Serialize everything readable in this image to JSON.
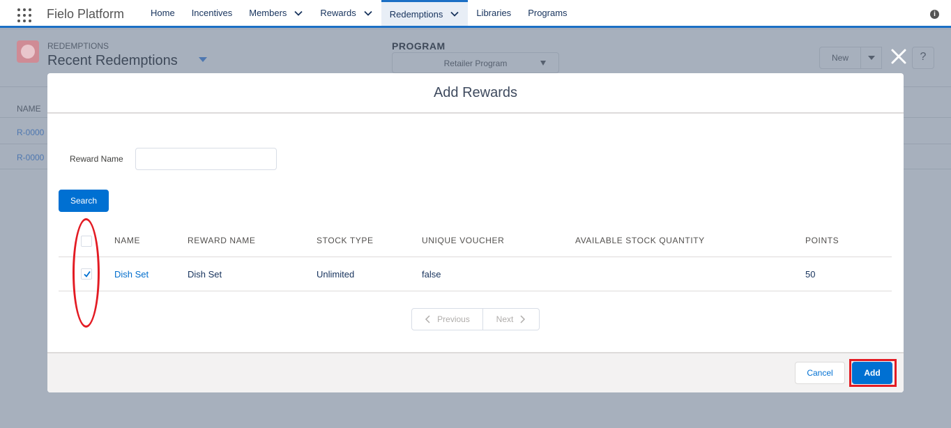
{
  "nav": {
    "app_name": "Fielo Platform",
    "tabs": [
      {
        "label": "Home",
        "dropdown": false
      },
      {
        "label": "Incentives",
        "dropdown": false
      },
      {
        "label": "Members",
        "dropdown": true
      },
      {
        "label": "Rewards",
        "dropdown": true
      },
      {
        "label": "Redemptions",
        "dropdown": true,
        "active": true
      },
      {
        "label": "Libraries",
        "dropdown": false
      },
      {
        "label": "Programs",
        "dropdown": false
      }
    ],
    "info_icon": "i"
  },
  "background": {
    "object_label": "REDEMPTIONS",
    "list_view_title": "Recent Redemptions",
    "program_label": "PROGRAM",
    "program_value": "Retailer Program",
    "new_button": "New",
    "help_button": "?",
    "column_header": "NAME",
    "rows": [
      "R-0000",
      "R-0000"
    ]
  },
  "modal": {
    "title": "Add Rewards",
    "reward_name_label": "Reward Name",
    "reward_name_value": "",
    "search_button": "Search",
    "table": {
      "headers": [
        "NAME",
        "REWARD NAME",
        "STOCK TYPE",
        "UNIQUE VOUCHER",
        "AVAILABLE STOCK QUANTITY",
        "POINTS"
      ],
      "rows": [
        {
          "checked": true,
          "name": "Dish Set",
          "reward_name": "Dish Set",
          "stock_type": "Unlimited",
          "unique_voucher": "false",
          "available_stock_quantity": "",
          "points": "50"
        }
      ]
    },
    "pager": {
      "previous": "Previous",
      "next": "Next"
    },
    "cancel_button": "Cancel",
    "add_button": "Add"
  },
  "colors": {
    "brand_blue": "#0070d2",
    "nav_accent": "#1b6fc5",
    "annotation_red": "#e31b23",
    "overlay": "#a3acbb"
  }
}
